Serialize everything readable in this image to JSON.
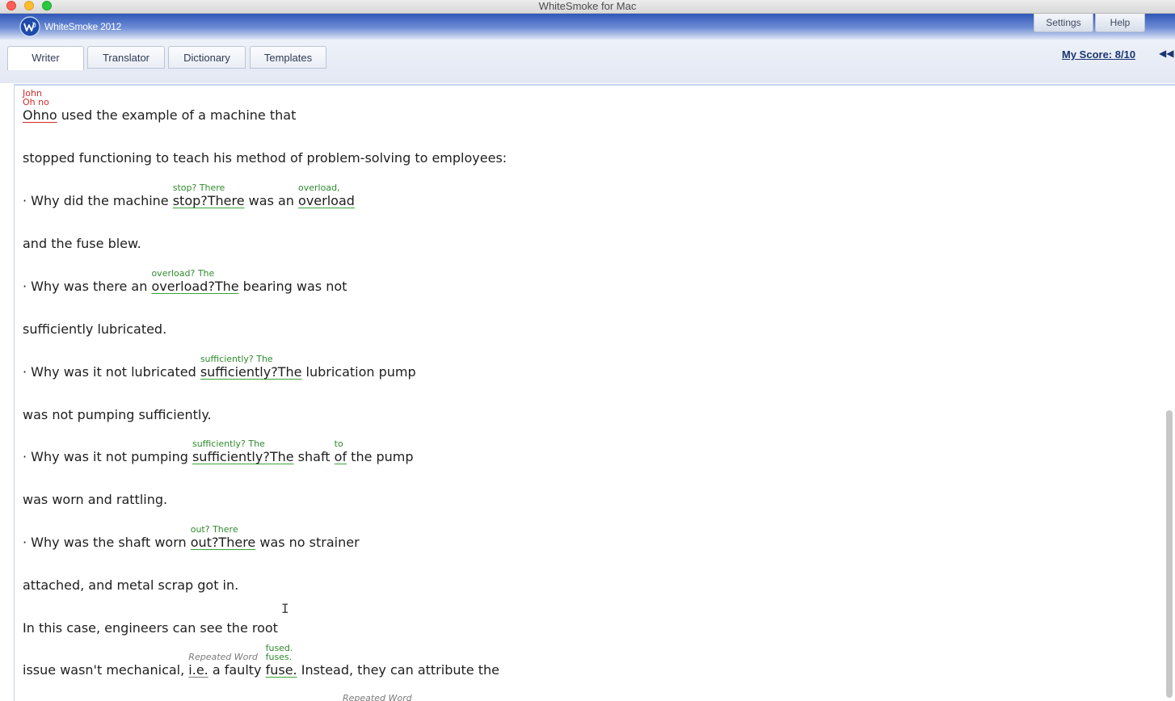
{
  "window": {
    "title": "WhiteSmoke for Mac"
  },
  "app": {
    "name": "WhiteSmoke 2012",
    "logo_icon": "whitesmoke-logo-icon"
  },
  "top_buttons": {
    "settings": "Settings",
    "help": "Help"
  },
  "tabs": [
    "Writer",
    "Translator",
    "Dictionary",
    "Templates"
  ],
  "active_tab": "Writer",
  "score": {
    "label": "My Score: 8/10",
    "collapse_icon": "double-chevron-left-icon"
  },
  "colors": {
    "grammar": "#2e8b2e",
    "spelling": "#d02a2a",
    "style": "#7a7a7a",
    "header": "#2f57b8"
  },
  "editor": {
    "lines": [
      {
        "before": "",
        "flag": "Ohno",
        "sugg_a": "John",
        "sugg_b": "Oh no",
        "after": " used the example of a machine that"
      },
      {
        "text": "stopped functioning to teach his method of problem-solving to employees:"
      },
      {
        "before": "· Why did the machine ",
        "flag": "stop?There",
        "sugg": "stop? There",
        "mid": " was an ",
        "flag2": "overload",
        "sugg2": "overload,"
      },
      {
        "text": "and the fuse blew."
      },
      {
        "before": "· Why was there an ",
        "flag": "overload?The",
        "sugg": "overload? The",
        "after": " bearing was not"
      },
      {
        "text": "sufficiently lubricated."
      },
      {
        "before": "· Why was it not lubricated ",
        "flag": "sufficiently?The",
        "sugg": "sufficiently? The",
        "after": " lubrication pump"
      },
      {
        "text": "was not pumping sufficiently."
      },
      {
        "before": "· Why was it not pumping ",
        "flag": "sufficiently?The",
        "sugg": "sufficiently? The",
        "mid": " shaft ",
        "flag2": "of",
        "sugg2": "to",
        "after": " the pump"
      },
      {
        "text": "was worn and rattling."
      },
      {
        "before": "· Why was the shaft worn ",
        "flag": "out?There",
        "sugg": "out? There",
        "after": " was no strainer"
      },
      {
        "text": "attached, and metal scrap got in."
      },
      {
        "text": "In this case, engineers can see the root"
      },
      {
        "before": "issue wasn't mechanical, ",
        "flag": "i.e.",
        "sugg": "Repeated Word",
        "mid": " a faulty ",
        "flag2": "fuse.",
        "sugg2_a": "fused.",
        "sugg2_b": "fuses.",
        "after": " Instead, they can attribute the"
      }
    ],
    "partial_next_hint": "Repeated Word"
  }
}
